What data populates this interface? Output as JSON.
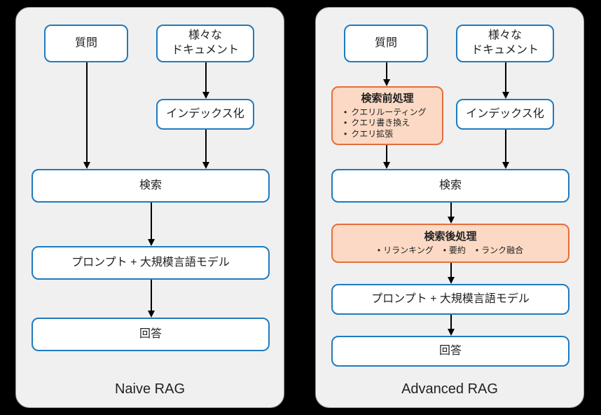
{
  "naive": {
    "title": "Naive RAG",
    "question": "質問",
    "documents": "様々な\nドキュメント",
    "indexing": "インデックス化",
    "retrieval": "検索",
    "prompt_llm": "プロンプト + 大規模言語モデル",
    "answer": "回答"
  },
  "advanced": {
    "title": "Advanced RAG",
    "question": "質問",
    "documents": "様々な\nドキュメント",
    "pre_title": "検索前処理",
    "pre_items": [
      "クエリルーティング",
      "クエリ書き換え",
      "クエリ拡張"
    ],
    "indexing": "インデックス化",
    "retrieval": "検索",
    "post_title": "検索後処理",
    "post_items": [
      "リランキング",
      "要約",
      "ランク融合"
    ],
    "prompt_llm": "プロンプト + 大規模言語モデル",
    "answer": "回答"
  }
}
